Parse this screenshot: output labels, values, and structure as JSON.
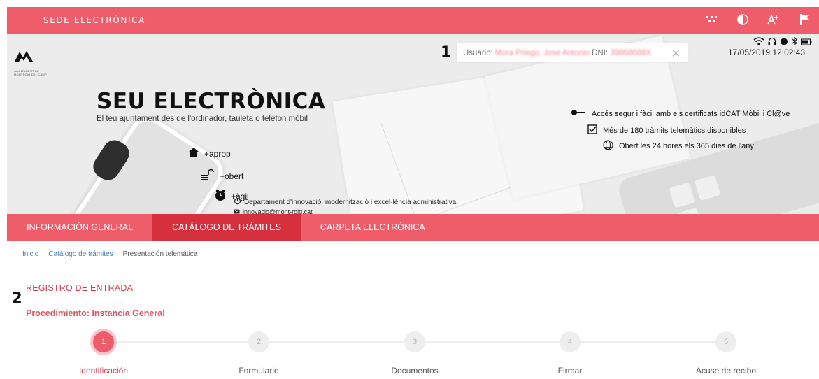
{
  "topbar": {
    "brand": "SEDE ELECTRÓNICA",
    "tools": [
      "apps-grid-icon",
      "contrast-icon",
      "font-size-icon",
      "language-flag-icon"
    ]
  },
  "banner": {
    "logo_text": "AJUNTAMENT DE MONTROIG DEL CAMP",
    "title": "SEU ELECTRÒNICA",
    "subtitle": "El teu ajuntament des de l'ordinador, tauleta o telèfon mòbil",
    "features": [
      "+aprop",
      "+obert",
      "+àgil"
    ],
    "bullets": [
      "Accés segur i fàcil amb els certificats idCAT Mòbil i Cl@ve",
      "Més de 180 tràmits telemàtics disponibles",
      "Obert les 24 hores els 365 dies de l'any"
    ],
    "department": "Departament d'innovació, modernització i excel·lència administrativa",
    "email": "innovacio@mont-roig.cat"
  },
  "user": {
    "label_user": "Usuario:",
    "name": "Mora Priego, Jose Antonio",
    "label_dni": "DNI:",
    "dni": "39868688X",
    "datetime": "17/05/2019 12:02:43"
  },
  "markers": [
    "1",
    "2"
  ],
  "nav": {
    "items": [
      {
        "label": "INFORMACIÓN GENERAL"
      },
      {
        "label": "CATÁLOGO DE TRÁMITES"
      },
      {
        "label": "CARPETA ELECTRÓNICA"
      }
    ]
  },
  "breadcrumb": {
    "home": "Inicio",
    "catalog": "Catálogo de trámites",
    "current": "Presentación telemática"
  },
  "registro": {
    "title": "REGISTRO DE ENTRADA",
    "procedure": "Procedimiento: Instancia General"
  },
  "steps": [
    {
      "number": "1",
      "label": "Identificación"
    },
    {
      "number": "2",
      "label": "Formulario"
    },
    {
      "number": "3",
      "label": "Documentos"
    },
    {
      "number": "4",
      "label": "Firmar"
    },
    {
      "number": "5",
      "label": "Acuse de recibo"
    }
  ],
  "colors": {
    "brand": "#ef5d6b",
    "brand_dark": "#d6303f",
    "link": "#4a7fb5"
  }
}
